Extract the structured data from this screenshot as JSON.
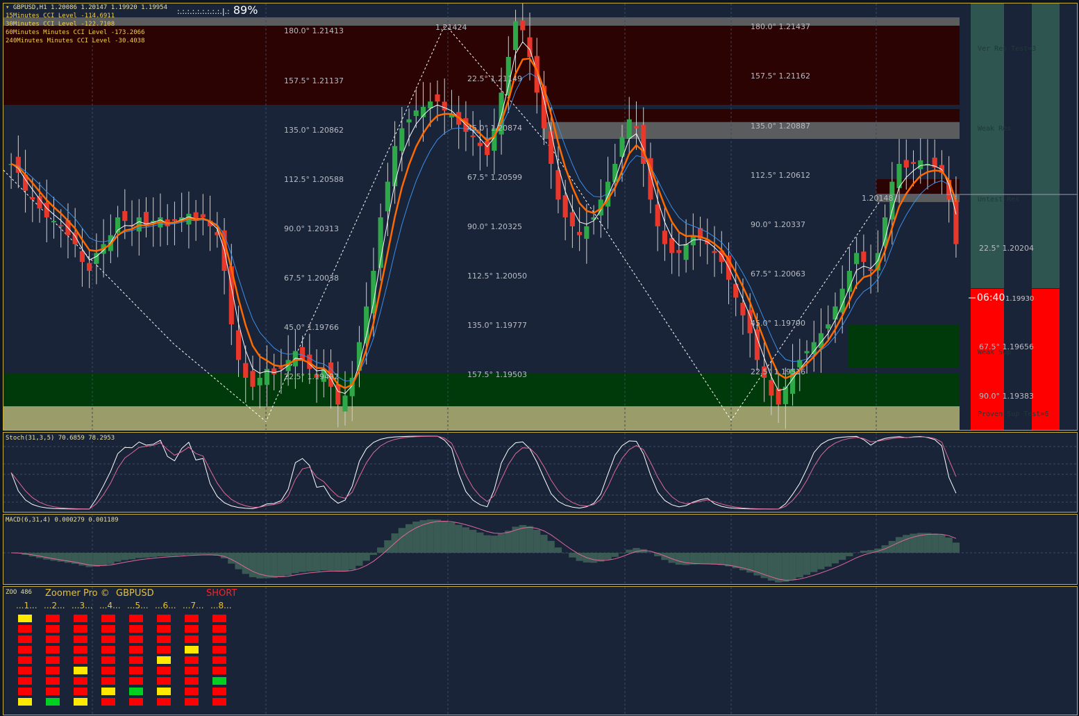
{
  "chart_info": {
    "symbol_line": "GBPUSD,H1  1.20086 1.20147 1.19920 1.19954",
    "cci_lines": [
      "15Minutes CCI Level -114.6911",
      "30Minutes CCI Level -122.7108",
      "60Minutes Minutes CCI Level -173.2066",
      "240Minutes Minutes CCI Level -30.4038"
    ],
    "progress_text": "89%",
    "countdown": "06:40",
    "price_tag": "1.19930"
  },
  "levels_left": [
    {
      "label": "180.0° 1.21413"
    },
    {
      "label": "157.5° 1.21137"
    },
    {
      "label": "135.0° 1.20862"
    },
    {
      "label": "112.5° 1.20588"
    },
    {
      "label": "90.0° 1.20313"
    },
    {
      "label": "67.5° 1.20038"
    },
    {
      "label": "45.0° 1.19766"
    },
    {
      "label": "22.5° 1.19492"
    }
  ],
  "levels_mid": [
    {
      "label": "1.21424"
    },
    {
      "label": "22.5° 1.21149"
    },
    {
      "label": "45.0° 1.20874"
    },
    {
      "label": "67.5° 1.20599"
    },
    {
      "label": "90.0° 1.20325"
    },
    {
      "label": "112.5° 1.20050"
    },
    {
      "label": "135.0° 1.19777"
    },
    {
      "label": "157.5° 1.19503"
    }
  ],
  "levels_right": [
    {
      "label": "180.0° 1.21437"
    },
    {
      "label": "157.5° 1.21162"
    },
    {
      "label": "135.0° 1.20887"
    },
    {
      "label": "112.5° 1.20612"
    },
    {
      "label": "90.0° 1.20337"
    },
    {
      "label": "67.5° 1.20063"
    },
    {
      "label": "45.0° 1.19790"
    },
    {
      "label": "22.5° 1.19516"
    },
    {
      "label": "1.20148"
    }
  ],
  "levels_far": [
    {
      "label": "22.5° 1.20204"
    },
    {
      "label": "67.5° 1.19656"
    },
    {
      "label": "90.0° 1.19383"
    }
  ],
  "zone_labels": {
    "ver_res": "Ver Res  Test=3",
    "weak_res": "Weak Res",
    "untest_res": "Untest Res",
    "weak_sup": "Weak Sup",
    "proven_sup": "Proven Sup  Test=6"
  },
  "stoch": {
    "label": "Stoch(31,3,5) 70.6859 78.2953"
  },
  "macd": {
    "label": "MACD(6,31,4) 0.000279 0.001189"
  },
  "zoo": {
    "id": "ZOO 486",
    "title": "Zoomer Pro ©",
    "symbol": "GBPUSD",
    "signal": "SHORT",
    "columns": [
      {
        "label": "...1...",
        "cells": [
          "yellow",
          "red",
          "red",
          "red",
          "red",
          "red",
          "red",
          "red",
          "yellow"
        ]
      },
      {
        "label": "...2...",
        "cells": [
          "red",
          "red",
          "red",
          "red",
          "red",
          "red",
          "red",
          "red",
          "green"
        ]
      },
      {
        "label": "...3...",
        "cells": [
          "red",
          "red",
          "red",
          "red",
          "red",
          "yellow",
          "red",
          "red",
          "yellow"
        ]
      },
      {
        "label": "...4...",
        "cells": [
          "red",
          "red",
          "red",
          "red",
          "red",
          "red",
          "red",
          "yellow",
          "red"
        ]
      },
      {
        "label": "...5...",
        "cells": [
          "red",
          "red",
          "red",
          "red",
          "red",
          "red",
          "red",
          "green",
          "red"
        ]
      },
      {
        "label": "...6...",
        "cells": [
          "red",
          "red",
          "red",
          "red",
          "yellow",
          "red",
          "red",
          "yellow",
          "red"
        ]
      },
      {
        "label": "...7...",
        "cells": [
          "red",
          "red",
          "red",
          "yellow",
          "red",
          "red",
          "red",
          "red",
          "red"
        ]
      },
      {
        "label": "...8...",
        "cells": [
          "red",
          "red",
          "red",
          "red",
          "red",
          "red",
          "green",
          "red",
          "red"
        ]
      }
    ]
  },
  "colors": {
    "background": "#1a2439",
    "bull_candle": "#2fa84a",
    "bear_candle": "#e8382c",
    "ma_orange": "#ff6a00",
    "ma_white": "#ffffff",
    "ma_blue": "#3a8ee8",
    "resistance_zone": "#2b0303",
    "support_zone": "#003a0a",
    "proven_zone": "#9a9c6a",
    "signal_red": "#ff0000",
    "signal_yellow": "#ffea00",
    "signal_green": "#00d020"
  },
  "chart_data": {
    "type": "candlestick",
    "symbol": "GBPUSD",
    "timeframe": "H1",
    "last_bar": {
      "open": 1.20086,
      "high": 1.20147,
      "low": 1.1992,
      "close": 1.19954
    },
    "ylim": [
      1.191,
      1.215
    ],
    "close_series": [
      1.206,
      1.2055,
      1.2045,
      1.204,
      1.2035,
      1.203,
      1.2028,
      1.2025,
      1.202,
      1.2015,
      1.2005,
      1.2,
      1.201,
      1.2015,
      1.202,
      1.203,
      1.2028,
      1.2025,
      1.203,
      1.2025,
      1.2028,
      1.203,
      1.2025,
      1.2028,
      1.203,
      1.2032,
      1.2028,
      1.203,
      1.2025,
      1.202,
      1.2,
      1.197,
      1.195,
      1.194,
      1.1935,
      1.194,
      1.1945,
      1.1942,
      1.1945,
      1.195,
      1.1955,
      1.195,
      1.1945,
      1.194,
      1.1945,
      1.1935,
      1.1925,
      1.193,
      1.194,
      1.196,
      1.198,
      1.2,
      1.203,
      1.205,
      1.207,
      1.208,
      1.2085,
      1.209,
      1.2092,
      1.2095,
      1.2095,
      1.209,
      1.2088,
      1.2082,
      1.2078,
      1.2075,
      1.207,
      1.2065,
      1.208,
      1.21,
      1.212,
      1.214,
      1.2135,
      1.212,
      1.21,
      1.208,
      1.206,
      1.204,
      1.203,
      1.2025,
      1.202,
      1.2025,
      1.203,
      1.204,
      1.205,
      1.206,
      1.2075,
      1.2085,
      1.208,
      1.206,
      1.204,
      1.2025,
      1.2015,
      1.201,
      1.201,
      1.2015,
      1.202,
      1.2018,
      1.2015,
      1.201,
      1.2005,
      1.1995,
      1.1985,
      1.1975,
      1.1965,
      1.195,
      1.194,
      1.193,
      1.1925,
      1.1935,
      1.1945,
      1.195,
      1.1955,
      1.196,
      1.1965,
      1.197,
      1.198,
      1.199,
      1.2,
      1.201,
      1.2005,
      1.2,
      1.201,
      1.203,
      1.205,
      1.206,
      1.2058,
      1.206,
      1.2062,
      1.206,
      1.2058,
      1.2055,
      1.204,
      1.2015
    ]
  }
}
